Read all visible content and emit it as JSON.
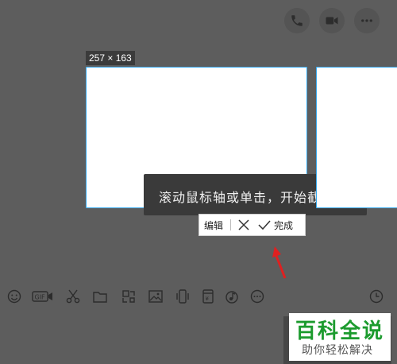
{
  "header": {
    "icons": [
      "phone-icon",
      "video-icon",
      "more-icon"
    ]
  },
  "screenshot": {
    "size_label": "257 × 163",
    "tooltip_text": "滚动鼠标轴或单击，开始截"
  },
  "edit_toolbar": {
    "edit_label": "编辑",
    "done_label": "完成"
  },
  "input_toolbar": {
    "icons": [
      "emoji-icon",
      "gif-icon",
      "scissors-icon",
      "folder-icon",
      "sticker-icon",
      "image-icon",
      "phone-shake-icon",
      "red-packet-icon",
      "music-icon",
      "more-circle-icon",
      "clock-icon"
    ]
  },
  "watermark": {
    "title": "百科全说",
    "subtitle": "助你轻松解决"
  },
  "colors": {
    "background": "#5d5d5d",
    "selection_border": "#33a8ef",
    "watermark_green": "#1c9b2e",
    "arrow_red": "#e02020"
  }
}
